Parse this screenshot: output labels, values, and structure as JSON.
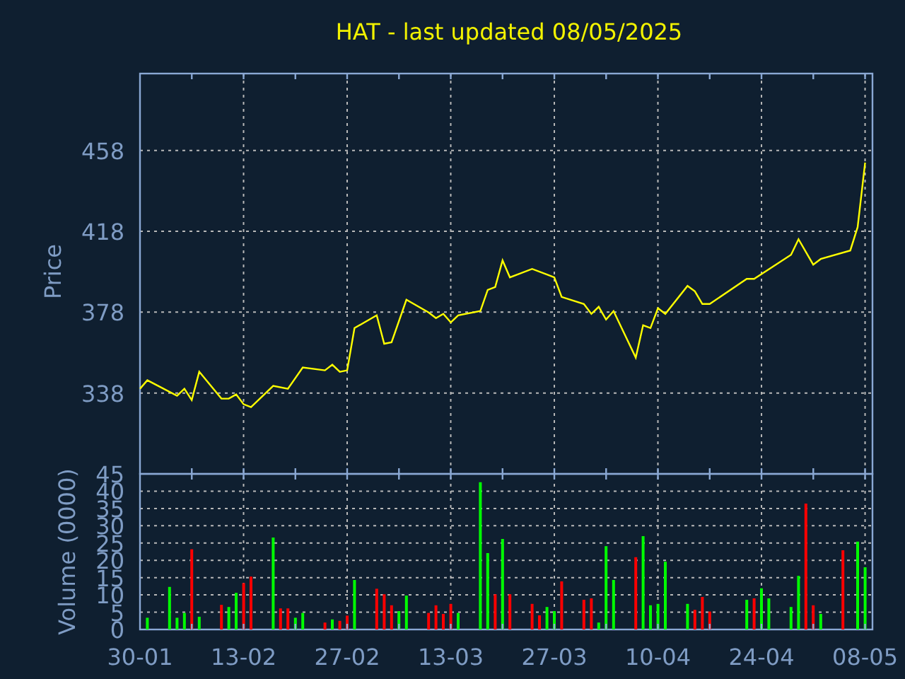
{
  "title": "HAT - last updated 08/05/2025",
  "price_chart": {
    "chart_data": {
      "type": "line",
      "ylabel": "Price",
      "categories": [
        null,
        null,
        null,
        null,
        null,
        null,
        null,
        null,
        null,
        null,
        null,
        null,
        null,
        null,
        null,
        null,
        null,
        null,
        null,
        null,
        null,
        null,
        null,
        null,
        null,
        null,
        null,
        null,
        null,
        null,
        null,
        null,
        null,
        null,
        null,
        null,
        null,
        null,
        null,
        null,
        null,
        null,
        null,
        null,
        null,
        null,
        null,
        null,
        null,
        null,
        null,
        null,
        null,
        null,
        null,
        null,
        null,
        null,
        null,
        null,
        null,
        null,
        null,
        null,
        null,
        null,
        null,
        null,
        null,
        null,
        null,
        null,
        null,
        null,
        null,
        null,
        null,
        null,
        null,
        null,
        null,
        null,
        null,
        null,
        null,
        null,
        null,
        null,
        null,
        null,
        null,
        null,
        null,
        null,
        null,
        null,
        null,
        null,
        null
      ],
      "series": [
        {
          "color": "#ffff00",
          "values": [
            340.1,
            344.3,
            null,
            null,
            null,
            336.6,
            340.1,
            334.5,
            348.5,
            null,
            null,
            335.2,
            335.2,
            337.3,
            332.4,
            331.0,
            null,
            null,
            341.5,
            null,
            340.1,
            null,
            350.6,
            null,
            null,
            349.2,
            352.0,
            348.5,
            349.2,
            370.1,
            null,
            null,
            376.4,
            362.4,
            363.1,
            null,
            384.1,
            null,
            null,
            377.8,
            375.0,
            377.1,
            372.9,
            376.4,
            null,
            null,
            378.5,
            389.0,
            390.4,
            403.6,
            395.2,
            null,
            null,
            399.4,
            null,
            396.6,
            395.2,
            385.5,
            null,
            null,
            382.0,
            377.1,
            380.6,
            374.3,
            378.5,
            null,
            null,
            355.5,
            371.5,
            370.1,
            379.9,
            377.1,
            null,
            null,
            391.0,
            388.3,
            382.0,
            382.0,
            null,
            null,
            null,
            null,
            394.5,
            394.5,
            null,
            null,
            null,
            null,
            406.4,
            414.1,
            null,
            401.5,
            404.3,
            null,
            null,
            null,
            408.5,
            420.0,
            452.0
          ]
        }
      ],
      "ylim": [
        298,
        496
      ],
      "yticks": [
        338,
        378,
        418,
        458
      ]
    }
  },
  "volume_chart": {
    "chart_data": {
      "type": "bar",
      "ylabel": "Volume (0000)",
      "categories": [
        "30-01",
        null,
        null,
        null,
        null,
        null,
        null,
        null,
        null,
        null,
        null,
        null,
        null,
        null,
        "13-02",
        null,
        null,
        null,
        null,
        null,
        null,
        null,
        null,
        null,
        null,
        null,
        null,
        null,
        "27-02",
        null,
        null,
        null,
        null,
        null,
        null,
        null,
        null,
        null,
        null,
        null,
        null,
        null,
        "13-03",
        null,
        null,
        null,
        null,
        null,
        null,
        null,
        null,
        null,
        null,
        null,
        null,
        null,
        "27-03",
        null,
        null,
        null,
        null,
        null,
        null,
        null,
        null,
        null,
        null,
        null,
        null,
        null,
        "10-04",
        null,
        null,
        null,
        null,
        null,
        null,
        null,
        null,
        null,
        null,
        null,
        null,
        null,
        "24-04",
        null,
        null,
        null,
        null,
        null,
        null,
        null,
        null,
        null,
        null,
        null,
        null,
        null,
        "08-05"
      ],
      "series": [
        {
          "color": "#00ff00",
          "values": [
            null,
            3.4,
            null,
            null,
            12.3,
            3.4,
            4.8,
            null,
            3.7,
            null,
            null,
            null,
            6.5,
            10.6,
            null,
            null,
            null,
            null,
            26.6,
            null,
            null,
            3.4,
            4.8,
            null,
            null,
            null,
            2.9,
            null,
            null,
            14.3,
            null,
            null,
            null,
            null,
            null,
            5.3,
            9.8,
            null,
            null,
            null,
            null,
            null,
            null,
            4.8,
            null,
            null,
            42.6,
            22.1,
            null,
            26.2,
            null,
            null,
            null,
            null,
            null,
            6.5,
            5.3,
            null,
            null,
            null,
            null,
            null,
            2.0,
            24.1,
            14.3,
            null,
            null,
            null,
            27.0,
            7.0,
            7.4,
            19.6,
            null,
            null,
            7.4,
            null,
            null,
            null,
            null,
            null,
            null,
            null,
            8.6,
            null,
            11.9,
            9.0,
            null,
            null,
            6.5,
            15.5,
            null,
            null,
            4.5,
            null,
            null,
            null,
            null,
            25.4,
            18.0
          ]
        },
        {
          "color": "#ff0000",
          "values": [
            null,
            null,
            null,
            null,
            null,
            null,
            null,
            23.2,
            null,
            null,
            null,
            7.1,
            null,
            null,
            13.4,
            15.3,
            null,
            null,
            null,
            6.1,
            6.1,
            null,
            null,
            null,
            null,
            2.0,
            null,
            2.5,
            4.0,
            null,
            null,
            null,
            11.8,
            10.2,
            7.0,
            null,
            null,
            null,
            null,
            4.8,
            7.0,
            4.5,
            7.4,
            null,
            null,
            null,
            null,
            null,
            10.2,
            null,
            10.2,
            null,
            null,
            7.4,
            4.1,
            null,
            null,
            13.9,
            null,
            null,
            8.6,
            9.0,
            null,
            null,
            null,
            null,
            null,
            20.9,
            null,
            null,
            null,
            null,
            null,
            null,
            null,
            5.7,
            9.4,
            5.2,
            null,
            null,
            null,
            null,
            null,
            9.0,
            null,
            null,
            null,
            null,
            null,
            null,
            36.4,
            7.0,
            null,
            null,
            null,
            22.9,
            null,
            null,
            null
          ]
        }
      ],
      "ylim": [
        0,
        45
      ],
      "yticks": [
        0,
        5,
        10,
        15,
        20,
        25,
        30,
        35,
        40,
        45
      ]
    }
  }
}
